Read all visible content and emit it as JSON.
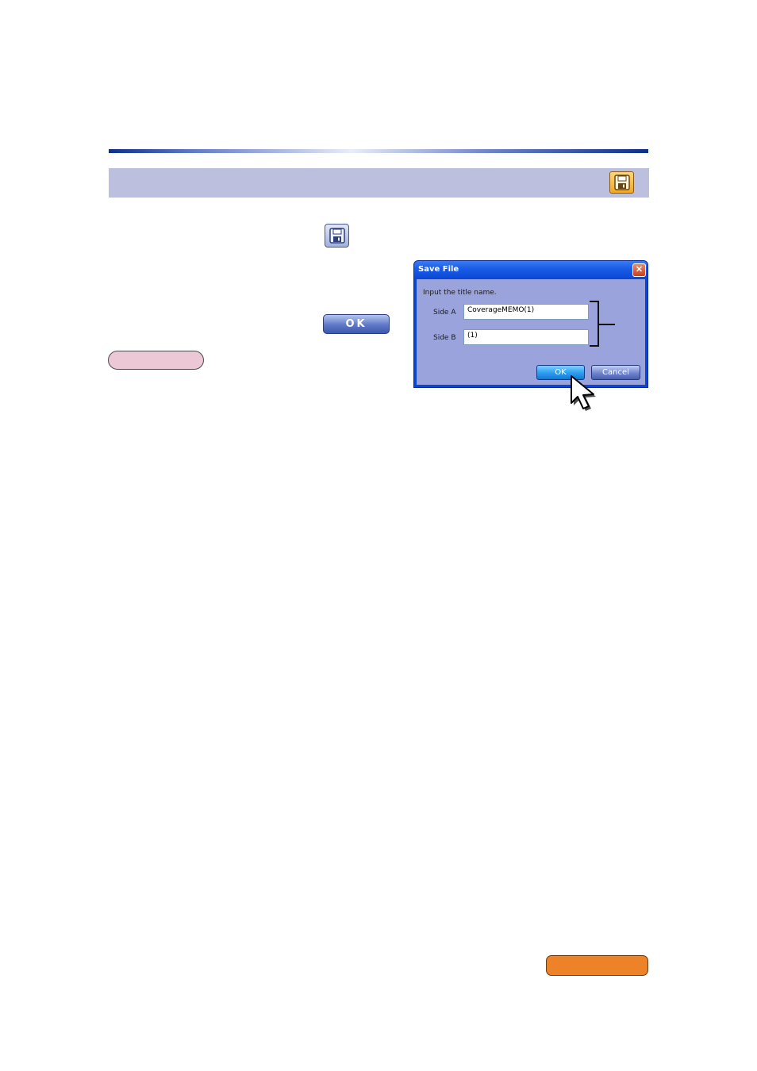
{
  "header": {
    "save_icon_orange": "floppy-disk-icon",
    "colors": {
      "rule": "#0d2f88",
      "band": "#bcc0de",
      "orange_icon": "#f4a81f"
    }
  },
  "toolbar_icon": {
    "icon": "floppy-disk-icon"
  },
  "ok_button": {
    "label": "OK"
  },
  "badges": {
    "pink_color": "#ecc7d6",
    "orange_color": "#ee8229"
  },
  "dialog": {
    "title": "Save File",
    "close_glyph": "✕",
    "prompt": "Input the title name.",
    "side_a": {
      "label": "Side A",
      "value": "CoverageMEMO(1)"
    },
    "side_b": {
      "label": "Side B",
      "value": "(1)"
    },
    "ok_label": "OK",
    "cancel_label": "Cancel"
  }
}
